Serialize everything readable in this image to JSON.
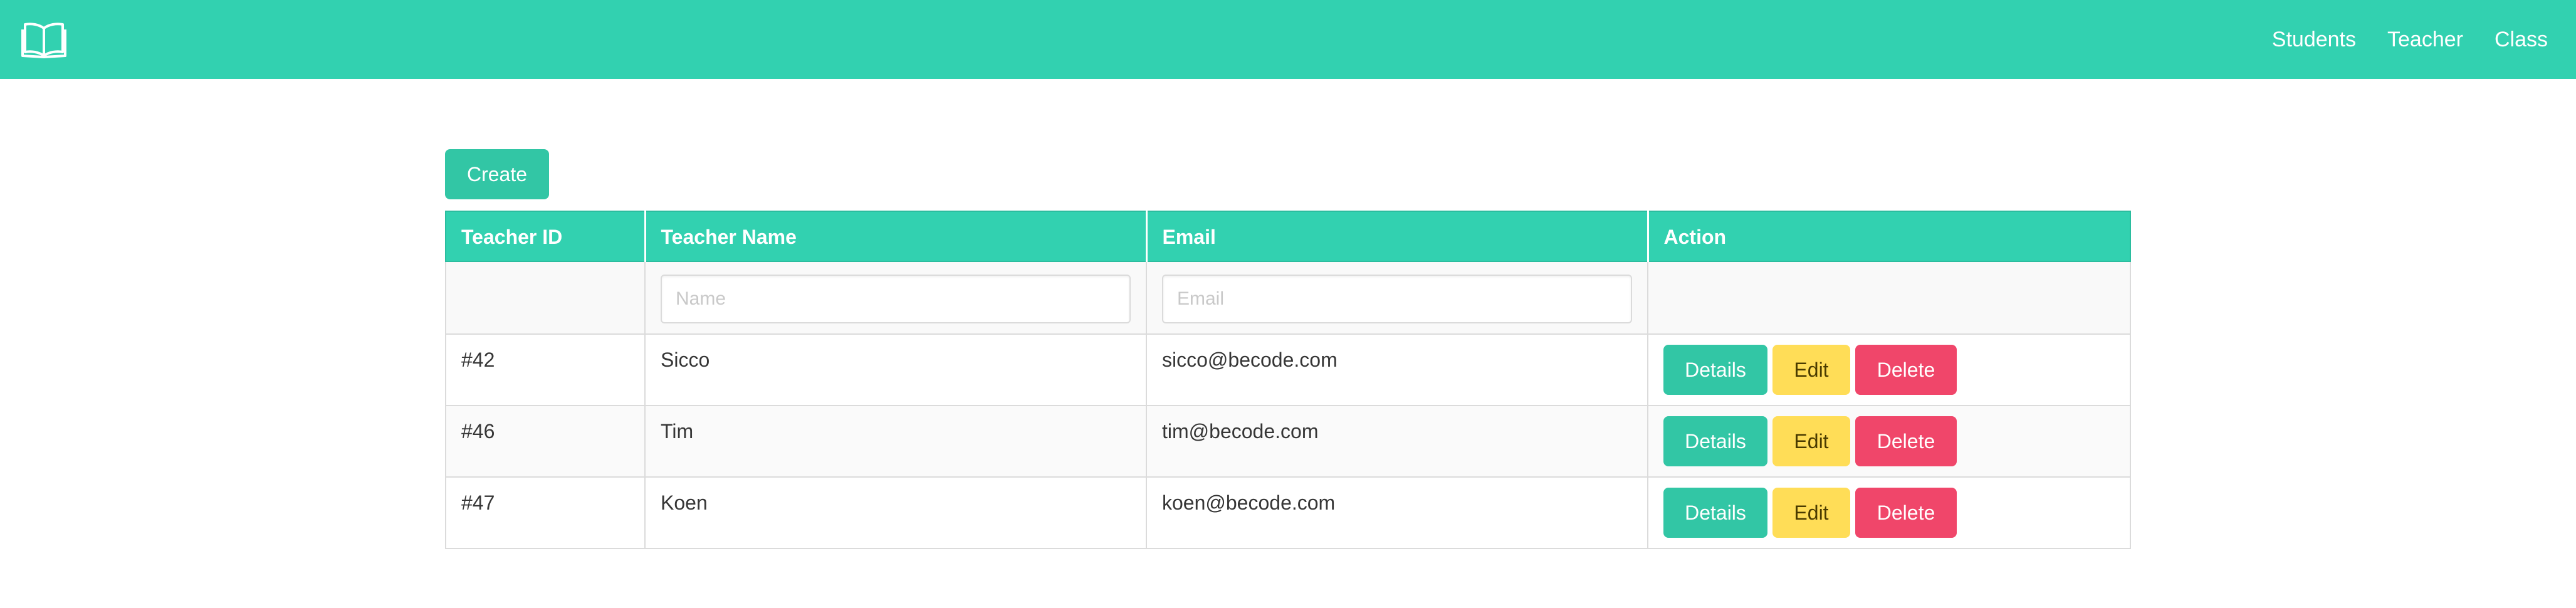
{
  "nav": {
    "brand_icon": "open-book-icon",
    "links": [
      "Students",
      "Teacher",
      "Class"
    ]
  },
  "colors": {
    "primary": "#32d1b0",
    "warning": "#ffdd57",
    "danger": "#f0466a"
  },
  "toolbar": {
    "create_label": "Create"
  },
  "table": {
    "headers": [
      "Teacher ID",
      "Teacher Name",
      "Email",
      "Action"
    ],
    "filters": {
      "name_placeholder": "Name",
      "email_placeholder": "Email"
    },
    "rows": [
      {
        "id": "#42",
        "name": "Sicco",
        "email": "sicco@becode.com"
      },
      {
        "id": "#46",
        "name": "Tim",
        "email": "tim@becode.com"
      },
      {
        "id": "#47",
        "name": "Koen",
        "email": "koen@becode.com"
      }
    ],
    "actions": {
      "details": "Details",
      "edit": "Edit",
      "delete": "Delete"
    }
  }
}
